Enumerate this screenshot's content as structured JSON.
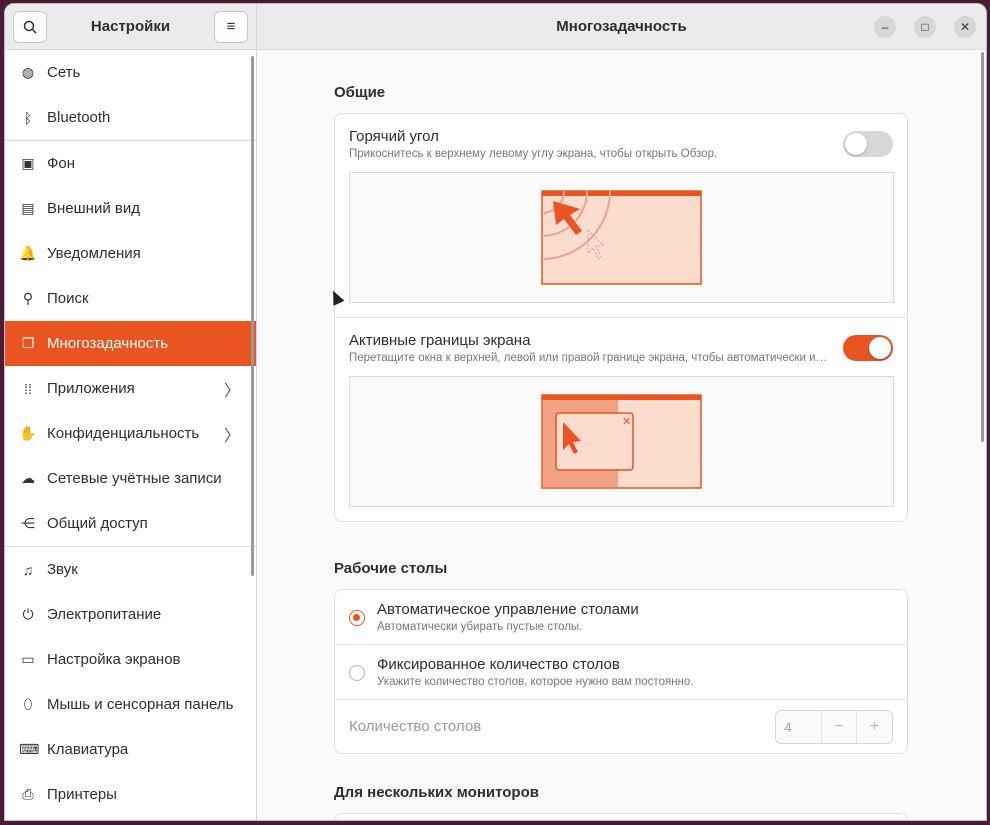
{
  "sidebar": {
    "title": "Настройки",
    "search_icon": "search-icon",
    "menu_icon": "hamburger-menu-icon",
    "items": [
      {
        "label": "Сеть",
        "icon": "globe-icon",
        "glyph": "◍"
      },
      {
        "label": "Bluetooth",
        "icon": "bluetooth-icon",
        "glyph": "ᛒ"
      },
      {
        "label": "Фон",
        "icon": "background-icon",
        "glyph": "▣"
      },
      {
        "label": "Внешний вид",
        "icon": "appearance-icon",
        "glyph": "▤"
      },
      {
        "label": "Уведомления",
        "icon": "bell-icon",
        "glyph": "🔔"
      },
      {
        "label": "Поиск",
        "icon": "search-icon",
        "glyph": "⚲"
      },
      {
        "label": "Многозадачность",
        "icon": "multitasking-icon",
        "glyph": "❐"
      },
      {
        "label": "Приложения",
        "icon": "apps-grid-icon",
        "glyph": "⁞⁞"
      },
      {
        "label": "Конфиденциальность",
        "icon": "privacy-hand-icon",
        "glyph": "✋"
      },
      {
        "label": "Сетевые учётные записи",
        "icon": "cloud-icon",
        "glyph": "☁"
      },
      {
        "label": "Общий доступ",
        "icon": "share-icon",
        "glyph": "⋲"
      },
      {
        "label": "Звук",
        "icon": "music-note-icon",
        "glyph": "♫"
      },
      {
        "label": "Электропитание",
        "icon": "power-icon",
        "glyph": "⏻"
      },
      {
        "label": "Настройка экранов",
        "icon": "display-icon",
        "glyph": "▭"
      },
      {
        "label": "Мышь и сенсорная панель",
        "icon": "mouse-icon",
        "glyph": "⬯"
      },
      {
        "label": "Клавиатура",
        "icon": "keyboard-icon",
        "glyph": "⌨"
      },
      {
        "label": "Принтеры",
        "icon": "printer-icon",
        "glyph": "⎙"
      }
    ],
    "active_index": 6
  },
  "main": {
    "title": "Многозадачность",
    "sections": {
      "general": {
        "title": "Общие",
        "hot_corner": {
          "title": "Горячий угол",
          "subtitle": "Прикоснитесь к верхнему левому углу экрана, чтобы открыть Обзор.",
          "enabled": false
        },
        "active_edges": {
          "title": "Активные границы экрана",
          "subtitle": "Перетащите окна к верхней, левой или правой границе экрана, чтобы автоматически изменить их размер.",
          "enabled": true
        }
      },
      "workspaces": {
        "title": "Рабочие столы",
        "dynamic": {
          "title": "Автоматическое управление столами",
          "subtitle": "Автоматически убирать пустые столы.",
          "checked": true
        },
        "fixed": {
          "title": "Фиксированное количество столов",
          "subtitle": "Укажите количество столов, которое нужно вам постоянно.",
          "checked": false
        },
        "count_label": "Количество столов",
        "count_value": "4",
        "minus": "−",
        "plus": "+"
      },
      "multi_monitor": {
        "title": "Для нескольких мониторов"
      }
    }
  },
  "colors": {
    "accent": "#e95420",
    "illustration_fill": "#fcdccf"
  }
}
